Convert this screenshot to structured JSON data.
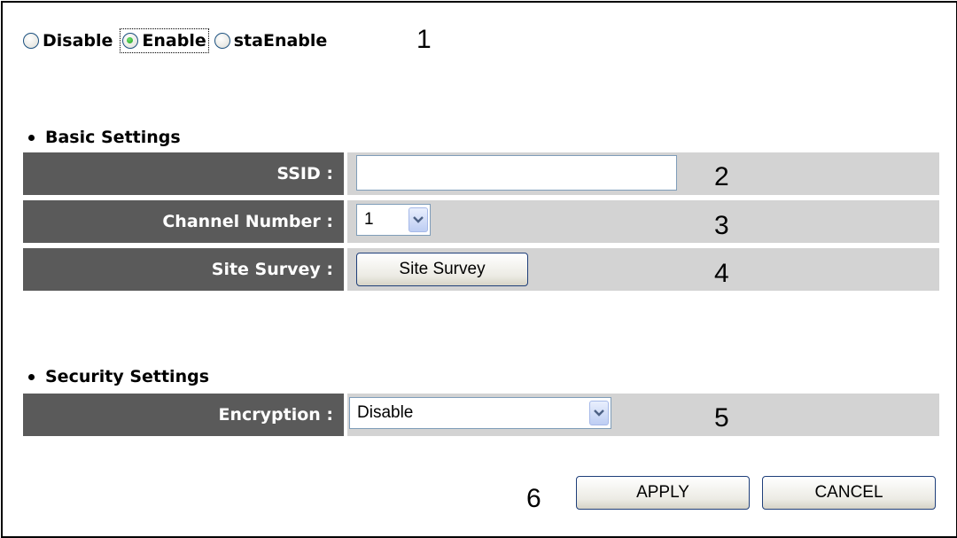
{
  "mode": {
    "options": [
      {
        "label": "Disable",
        "checked": false
      },
      {
        "label": "Enable",
        "checked": true
      },
      {
        "label": "staEnable",
        "checked": false
      }
    ]
  },
  "annotations": [
    "1",
    "2",
    "3",
    "4",
    "5",
    "6"
  ],
  "basic_settings": {
    "title": "Basic Settings",
    "ssid": {
      "label": "SSID :",
      "value": ""
    },
    "channel": {
      "label": "Channel Number :",
      "value": "1"
    },
    "site_survey": {
      "label": "Site Survey :",
      "button": "Site Survey"
    }
  },
  "security_settings": {
    "title": "Security Settings",
    "encryption": {
      "label": "Encryption :",
      "value": "Disable"
    }
  },
  "actions": {
    "apply": "APPLY",
    "cancel": "CANCEL"
  },
  "colors": {
    "label_bg": "#5a5a5a",
    "value_bg": "#d3d3d3",
    "accent": "#1f3f7a"
  }
}
